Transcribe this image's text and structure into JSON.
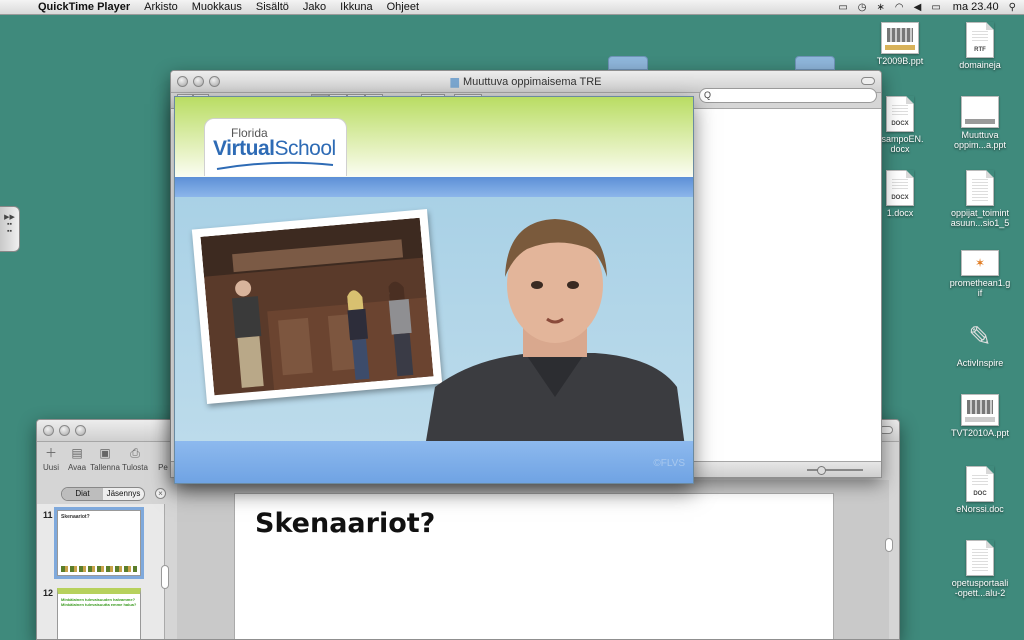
{
  "menubar": {
    "app_name": "QuickTime Player",
    "items": [
      "Arkisto",
      "Muokkaus",
      "Sisältö",
      "Jako",
      "Ikkuna",
      "Ohjeet"
    ],
    "clock": "ma 23.40"
  },
  "finder": {
    "title": "Muuttuva oppimaisema TRE",
    "search_value": "Q"
  },
  "ppt": {
    "toolbar": [
      "Uusi",
      "Avaa",
      "Tallenna",
      "Tulosta",
      "Pe"
    ],
    "view_toggle": [
      "Diat",
      "Jäsennys"
    ],
    "slides": [
      {
        "num": "11",
        "title": "Skenaariot?"
      },
      {
        "num": "12",
        "text_line1": "Minkälainen tulevaisuuden halvamme?",
        "text_line2": "Minkälainen tulevaisuutta emme halua?"
      }
    ],
    "slide_title": "Skenaariot?"
  },
  "video": {
    "logo_small": "Florida",
    "logo_virtual": "Virtual",
    "logo_school": "School",
    "watermark": "©FLVS"
  },
  "desktop_icons": [
    {
      "label_line1": "TVT2010A.ppt",
      "label_line2": ""
    },
    {
      "label_line1": "domaineja",
      "ext": "RTF"
    },
    {
      "label_line1": "esampoEN.",
      "label_line2": "docx",
      "ext": "DOCX"
    },
    {
      "label_line1": "Muuttuva",
      "label_line2": "oppim...a.ppt"
    },
    {
      "label_line1": "1.docx",
      "ext": "DOCX"
    },
    {
      "label_line1": "oppijat_toimint",
      "label_line2": "asuun...sio1_5"
    },
    {
      "label_line1": "promethean1.g",
      "label_line2": "if"
    },
    {
      "label_line1": "ActivInspire"
    },
    {
      "label_line1": "TVT2010A.ppt"
    },
    {
      "label_line1": "eNorssi.doc",
      "ext": "DOC"
    },
    {
      "label_line1": "opetusportaali",
      "label_line2": "-opett...alu-2"
    }
  ],
  "desktop_top_label": "T2009B.ppt",
  "colors": {
    "desktop": "#3f8a7c",
    "fvs_blue": "#2e6bb5",
    "header_green": "#b9dd63"
  }
}
